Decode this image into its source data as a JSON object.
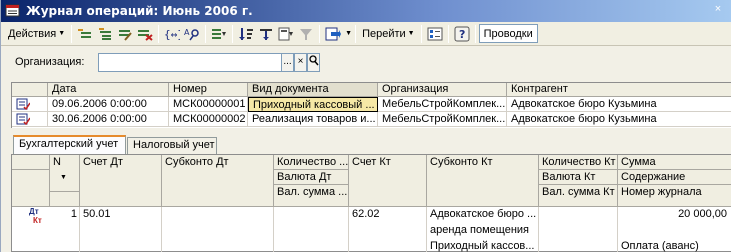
{
  "window": {
    "title": "Журнал операций: Июнь 2006 г.",
    "close_glyph": "×",
    "title_color": "#0a246a"
  },
  "toolbar": {
    "actions_label": "Действия",
    "goto_label": "Перейти",
    "help_label": "?",
    "postings_label": "Проводки",
    "icons": [
      "add-copy-icon",
      "add-group-icon",
      "edit-icon",
      "delete-mark-icon",
      "interval-icon",
      "find-icon",
      "filter-icon",
      "sort-asc-icon",
      "sort-desc-icon",
      "hierarchy-icon",
      "clear-filter-icon",
      "export-icon",
      "properties-icon",
      "help-icon"
    ]
  },
  "filter": {
    "org_label": "Организация:",
    "org_value": "",
    "dots": "...",
    "clear": "×",
    "search_glyph": "🔍"
  },
  "journal": {
    "columns": [
      "Дата",
      "Номер",
      "Вид документа",
      "Организация",
      "Контрагент"
    ],
    "rows": [
      {
        "date": "09.06.2006 0:00:00",
        "number": "МСК00000001",
        "doc_type": "Приходный кассовый ...",
        "org": "МебельСтройКомплек...",
        "counterparty": "Адвокатское бюро Кузьмина"
      },
      {
        "date": "30.06.2006 0:00:00",
        "number": "МСК00000002",
        "doc_type": "Реализация товаров и...",
        "org": "МебельСтройКомплек...",
        "counterparty": "Адвокатское бюро Кузьмина"
      }
    ]
  },
  "tabs": {
    "accounting": "Бухгалтерский учет",
    "tax": "Налоговый учет"
  },
  "postings": {
    "headers": {
      "n": "N",
      "sort_glyph": "▼",
      "dt_account": "Счет Дт",
      "dt_subconto": "Субконто Дт",
      "dt_qty": "Количество ...",
      "dt_currency": "Валюта Дт",
      "dt_cur_sum": "Вал. сумма ...",
      "kt_account": "Счет Кт",
      "kt_subconto": "Субконто Кт",
      "kt_qty": "Количество Кт",
      "kt_currency": "Валюта Кт",
      "kt_cur_sum": "Вал. сумма Кт",
      "sum": "Сумма",
      "content": "Содержание",
      "journal_no": "Номер журнала"
    },
    "row": {
      "icon_dt": "Дт",
      "icon_kt": "Кт",
      "n": "1",
      "dt_account": "50.01",
      "kt_account": "62.02",
      "kt_sub1": "Адвокатское бюро ...",
      "kt_sub2": "аренда помещения",
      "kt_sub3": "Приходный кассов...",
      "sum": "20 000,00",
      "content": "Оплата (аванс)"
    }
  }
}
